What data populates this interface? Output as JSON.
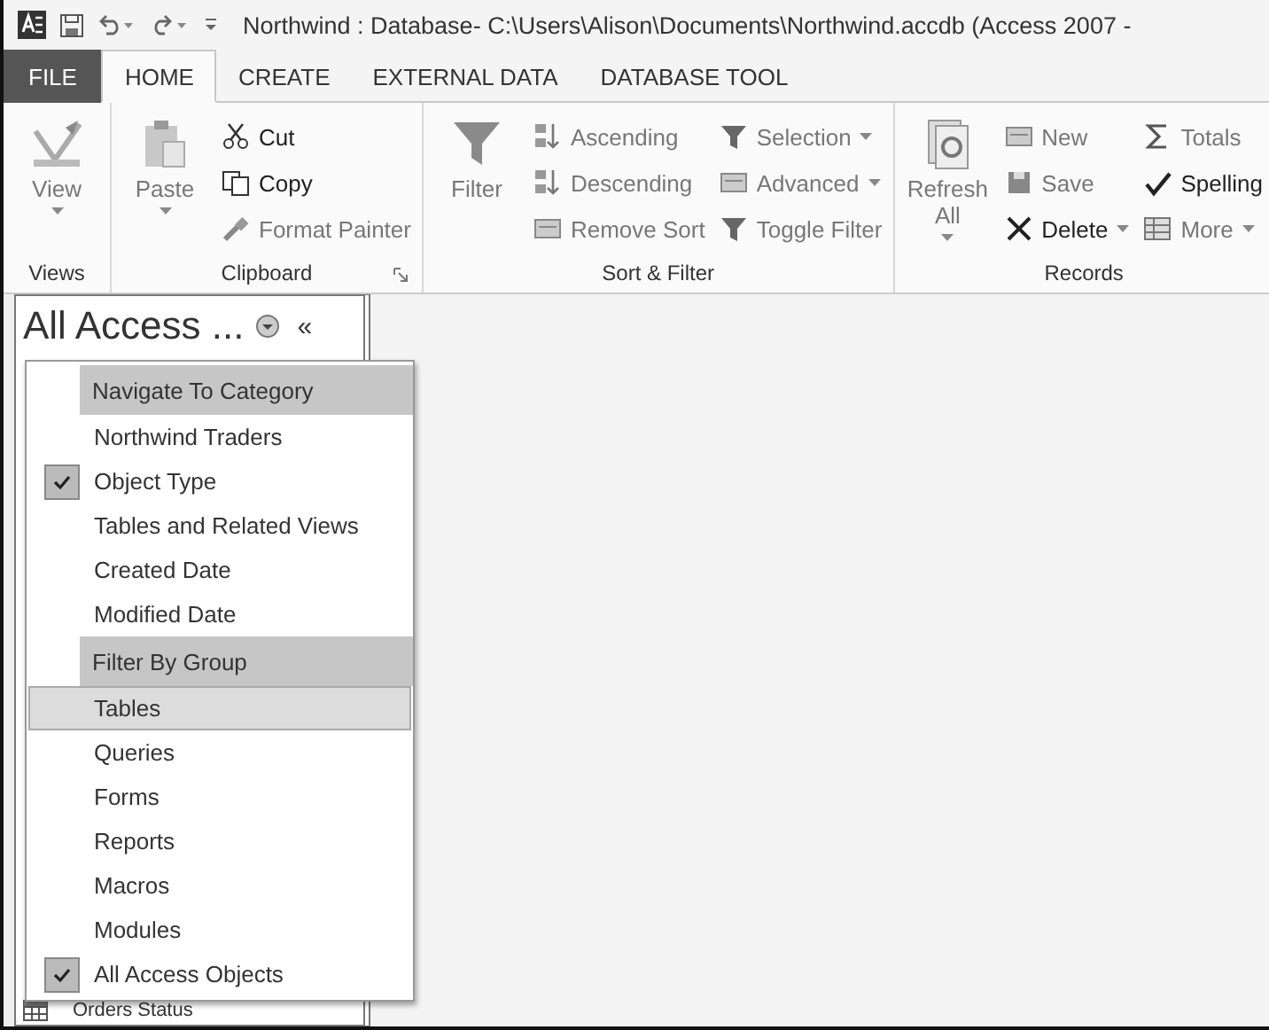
{
  "window": {
    "title": "Northwind : Database- C:\\Users\\Alison\\Documents\\Northwind.accdb (Access 2007 -"
  },
  "tabs": [
    {
      "label": "FILE",
      "kind": "file",
      "selected": false
    },
    {
      "label": "HOME",
      "kind": "tab",
      "selected": true
    },
    {
      "label": "CREATE",
      "kind": "tab",
      "selected": false
    },
    {
      "label": "EXTERNAL DATA",
      "kind": "tab",
      "selected": false
    },
    {
      "label": "DATABASE TOOL",
      "kind": "tab",
      "selected": false
    }
  ],
  "ribbon": [
    {
      "label": "Views",
      "launcher": false,
      "columns": [
        [
          {
            "label": "View",
            "kind": "large",
            "dropdown": true,
            "disabled": true
          }
        ]
      ]
    },
    {
      "label": "Clipboard",
      "launcher": true,
      "columns": [
        [
          {
            "label": "Paste",
            "kind": "large",
            "dropdown": true,
            "disabled": true
          }
        ],
        [
          {
            "label": "Cut",
            "kind": "small",
            "dropdown": false,
            "disabled": false
          },
          {
            "label": "Copy",
            "kind": "small",
            "dropdown": false,
            "disabled": false
          },
          {
            "label": "Format Painter",
            "kind": "small",
            "dropdown": false,
            "disabled": true
          }
        ]
      ]
    },
    {
      "label": "Sort & Filter",
      "launcher": false,
      "columns": [
        [
          {
            "label": "Filter",
            "kind": "large",
            "dropdown": false,
            "disabled": true
          }
        ],
        [
          {
            "label": "Ascending",
            "kind": "small",
            "dropdown": false,
            "disabled": true
          },
          {
            "label": "Descending",
            "kind": "small",
            "dropdown": false,
            "disabled": true
          },
          {
            "label": "Remove Sort",
            "kind": "small",
            "dropdown": false,
            "disabled": true
          }
        ],
        [
          {
            "label": "Selection",
            "kind": "small",
            "dropdown": true,
            "disabled": true
          },
          {
            "label": "Advanced",
            "kind": "small",
            "dropdown": true,
            "disabled": true
          },
          {
            "label": "Toggle Filter",
            "kind": "small",
            "dropdown": false,
            "disabled": true
          }
        ]
      ]
    },
    {
      "label": "Records",
      "launcher": false,
      "columns": [
        [
          {
            "label": "Refresh All",
            "kind": "large",
            "dropdown": true,
            "disabled": true
          }
        ],
        [
          {
            "label": "New",
            "kind": "small",
            "dropdown": false,
            "disabled": true
          },
          {
            "label": "Save",
            "kind": "small",
            "dropdown": false,
            "disabled": true
          },
          {
            "label": "Delete",
            "kind": "small",
            "dropdown": true,
            "disabled": false
          }
        ],
        [
          {
            "label": "Totals",
            "kind": "small",
            "dropdown": false,
            "disabled": true
          },
          {
            "label": "Spelling",
            "kind": "small",
            "dropdown": false,
            "disabled": false
          },
          {
            "label": "More",
            "kind": "small",
            "dropdown": true,
            "disabled": true
          }
        ]
      ]
    }
  ],
  "navigation_pane": {
    "title": "All Access ...",
    "collapse": "«",
    "items": [
      {
        "label": "Orders Status"
      }
    ]
  },
  "menu": [
    {
      "kind": "header",
      "label": "Navigate To Category"
    },
    {
      "kind": "item",
      "label": "Northwind Traders",
      "checked": false,
      "selected": false
    },
    {
      "kind": "item",
      "label": "Object Type",
      "checked": true,
      "selected": false
    },
    {
      "kind": "item",
      "label": "Tables and Related Views",
      "checked": false,
      "selected": false
    },
    {
      "kind": "item",
      "label": "Created Date",
      "checked": false,
      "selected": false
    },
    {
      "kind": "item",
      "label": "Modified Date",
      "checked": false,
      "selected": false
    },
    {
      "kind": "header",
      "label": "Filter By Group"
    },
    {
      "kind": "item",
      "label": "Tables",
      "checked": false,
      "selected": true
    },
    {
      "kind": "item",
      "label": "Queries",
      "checked": false,
      "selected": false
    },
    {
      "kind": "item",
      "label": "Forms",
      "checked": false,
      "selected": false
    },
    {
      "kind": "item",
      "label": "Reports",
      "checked": false,
      "selected": false
    },
    {
      "kind": "item",
      "label": "Macros",
      "checked": false,
      "selected": false
    },
    {
      "kind": "item",
      "label": "Modules",
      "checked": false,
      "selected": false
    },
    {
      "kind": "item",
      "label": "All Access Objects",
      "checked": true,
      "selected": false
    }
  ]
}
